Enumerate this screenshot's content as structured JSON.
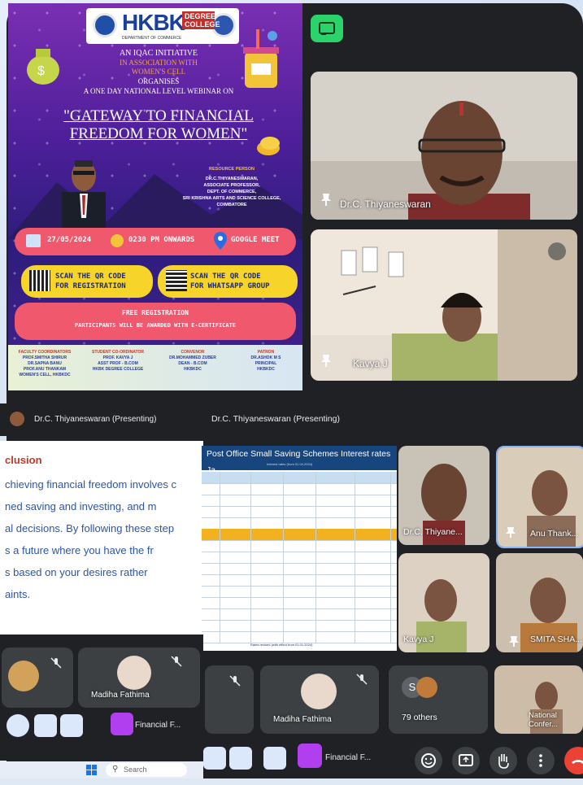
{
  "poster": {
    "logo": "HKBK",
    "logo_sub": "DEGREE COLLEGE",
    "dept": "DEPARTMENT OF COMMERCE",
    "line1": "AN IQAC INITIATIVE",
    "line2": "IN ASSOCIATION WITH",
    "line3": "WOMEN'S CELL",
    "line4": "ORGANISES",
    "line5": "A ONE DAY NATIONAL LEVEL WEBINAR ON",
    "title_line1": "\"GATEWAY TO FINANCIAL",
    "title_line2": "FREEDOM FOR WOMEN\"",
    "resource_heading": "RESOURCE PERSON",
    "resource_name": "DR.C.THIYANESWARAN,",
    "resource_role1": "ASSOCIATE PROFESSOR,",
    "resource_role2": "DEPT. OF COMMERCE,",
    "resource_role3": "SRI KRISHNA ARTS AND SCIENCE COLLEGE,",
    "resource_role4": "COIMBATORE",
    "date": "27/05/2024",
    "time": "0230 PM ONWARDS",
    "platform": "GOOGLE MEET",
    "qr1_line1": "SCAN THE QR CODE",
    "qr1_line2": "FOR REGISTRATION",
    "qr2_line1": "SCAN THE QR CODE",
    "qr2_line2": "FOR WHATSAPP GROUP",
    "free_line1": "FREE REGISTRATION",
    "free_line2": "PARTICIPANTS WILL BE AWARDED WITH E-CERTIFICATE",
    "footer": [
      {
        "head": "FACULTY COORDINATORS",
        "l1": "PROF.SMITHA SHIRUR",
        "l2": "DR.SAPNA BANU",
        "l3": "PROF.ANU THANKAM",
        "l4": "WOMEN'S CELL, HKBKDC"
      },
      {
        "head": "STUDENT CO-ORDINATOR",
        "l1": "PROF. KAVYA J",
        "l2": "ASST PROF - B.COM",
        "l3": "HKBK DEGREE COLLEGE",
        "l4": ""
      },
      {
        "head": "CONVENOR",
        "l1": "DR.MOHAMMED ZUBER",
        "l2": "DEAN - B.COM",
        "l3": "HKBKDC",
        "l4": ""
      },
      {
        "head": "PATRON",
        "l1": "DR.ASHOK M S",
        "l2": "PRINCIPAL",
        "l3": "HKBKDC",
        "l4": ""
      }
    ]
  },
  "meet": {
    "cast_icon": "cast-icon",
    "speaker_name": "Dr.C. Thiyaneswaran",
    "kavya_name": "Kavya J",
    "presenting_left": "Dr.C. Thiyaneswaran (Presenting)",
    "presenting_right": "Dr.C. Thiyaneswaran (Presenting)",
    "slide_title": "clusion",
    "slide_lines": [
      "chieving financial freedom involves c",
      "ned saving and investing, and m",
      "al decisions. By following these step",
      "s a future where you have the fr",
      "s based on your desires rather",
      "aints."
    ],
    "sheet_title": "Post Office Small Saving Schemes Interest rates Ja",
    "sheet_sub": "Interest rates (from 01.04.2024)",
    "sheet_footnote": "Rates revised (with effect from 01.01.2024)",
    "tiles": [
      {
        "name": "Dr.C. Thiyane..."
      },
      {
        "name": "Anu Thank..."
      },
      {
        "name": "Kavya J"
      },
      {
        "name": "SMITA SHA..."
      },
      {
        "name": "79 others"
      },
      {
        "name": "National Confer..."
      }
    ],
    "madiha_left": "Madiha Fathima",
    "madiha_right": "Madiha Fathima",
    "others_initial": "S",
    "truncated_left": "Financial F...",
    "truncated_right": "Financial F...",
    "search_placeholder": "Search"
  }
}
